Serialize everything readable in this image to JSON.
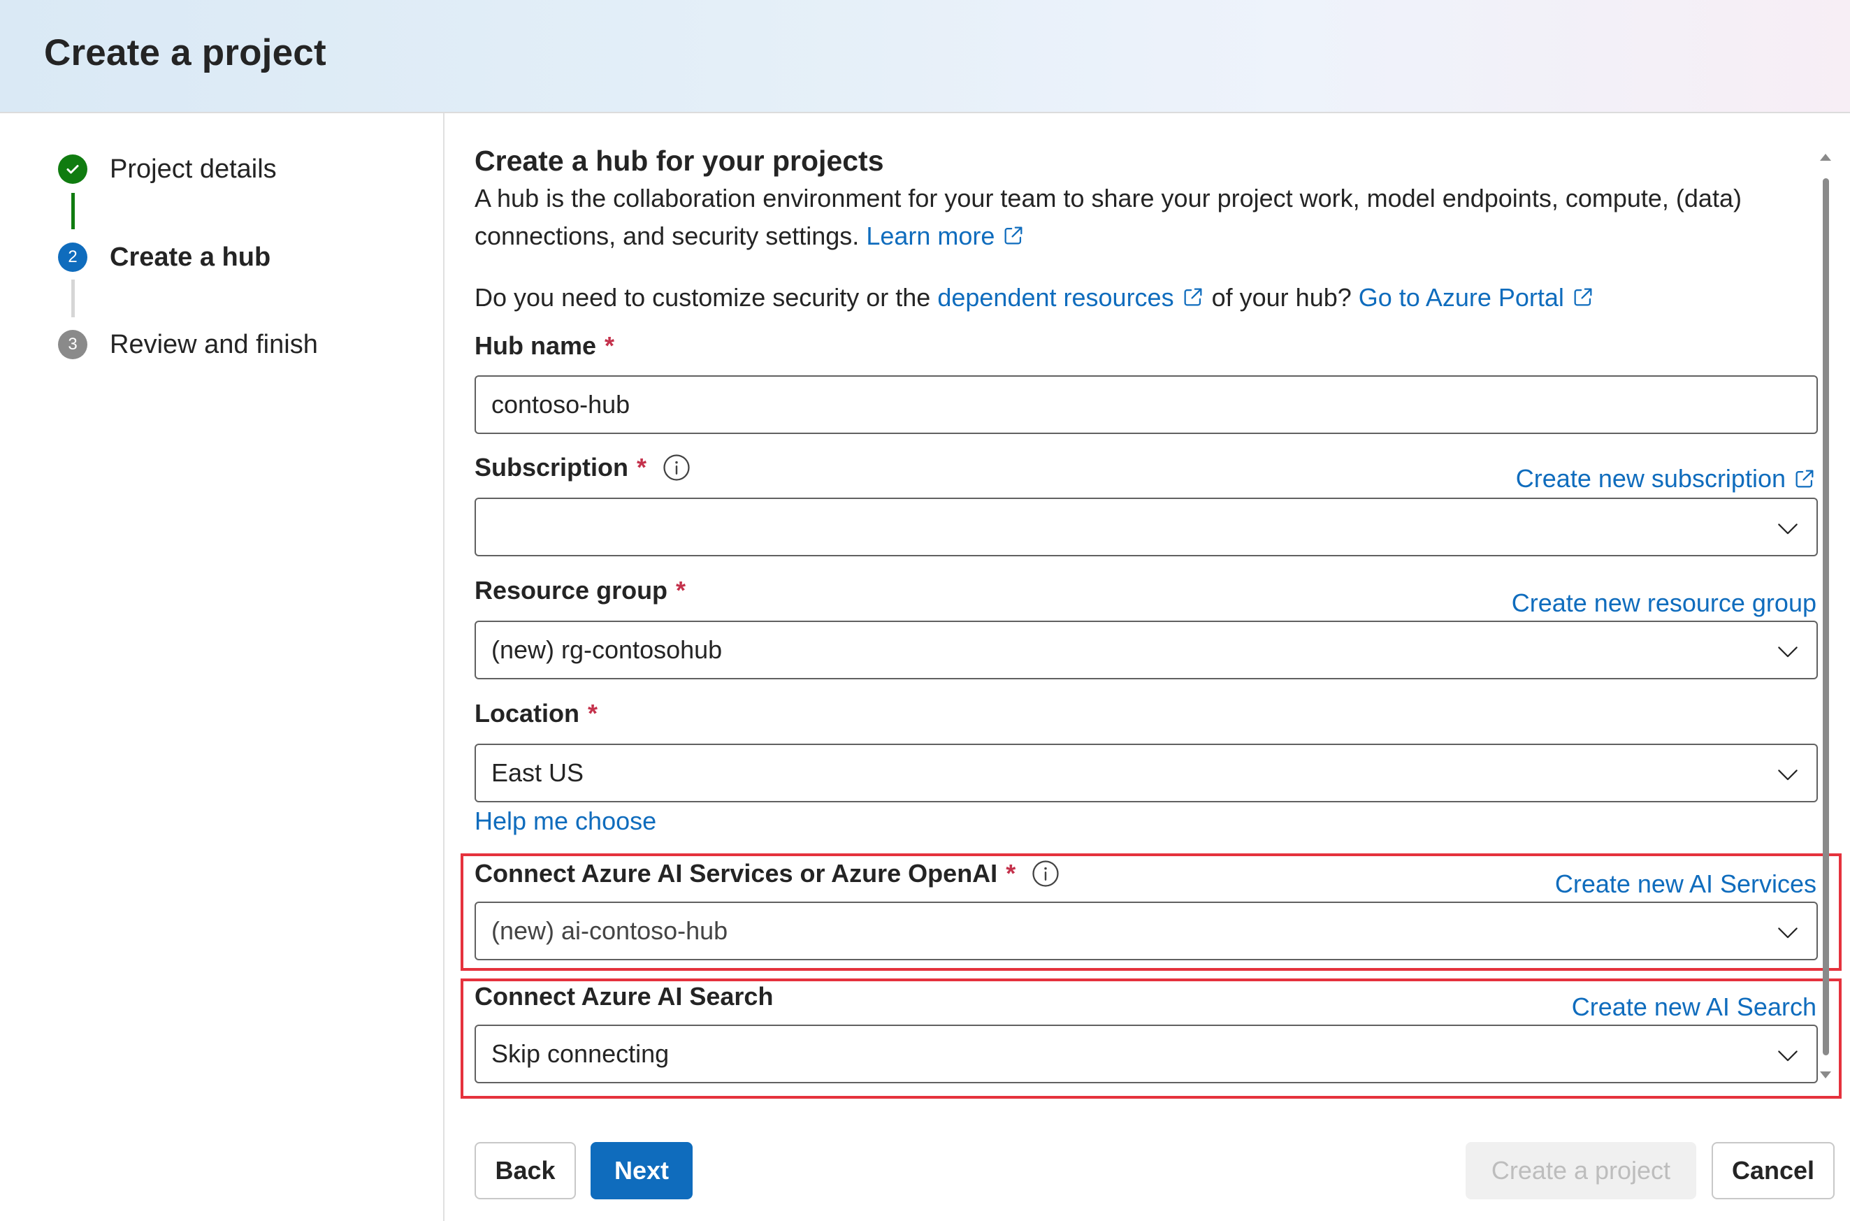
{
  "header": {
    "title": "Create a project"
  },
  "steps": [
    {
      "number": "1",
      "label": "Project details",
      "state": "done"
    },
    {
      "number": "2",
      "label": "Create a hub",
      "state": "current"
    },
    {
      "number": "3",
      "label": "Review and finish",
      "state": "todo"
    }
  ],
  "section": {
    "title": "Create a hub for your projects",
    "description": "A hub is the collaboration environment for your team to share your project work, model endpoints, compute, (data) connections, and security settings.",
    "learn_more": "Learn more",
    "customize_prefix": "Do you need to customize security or the",
    "dependent_resources": "dependent resources",
    "customize_middle": "of your hub?",
    "azure_portal": "Go to Azure Portal"
  },
  "fields": {
    "hub_name": {
      "label": "Hub name",
      "required": "*",
      "value": "contoso-hub"
    },
    "subscription": {
      "label": "Subscription",
      "required": "*",
      "value": "",
      "create_link": "Create new subscription"
    },
    "resource_group": {
      "label": "Resource group",
      "required": "*",
      "value": "(new) rg-contosohub",
      "create_link": "Create new resource group"
    },
    "location": {
      "label": "Location",
      "required": "*",
      "value": "East US",
      "help_link": "Help me choose"
    },
    "ai_services": {
      "label": "Connect Azure AI Services or Azure OpenAI",
      "required": "*",
      "value": "(new) ai-contoso-hub",
      "create_link": "Create new AI Services"
    },
    "ai_search": {
      "label": "Connect Azure AI Search",
      "value": "Skip connecting",
      "create_link": "Create new AI Search"
    }
  },
  "footer": {
    "back": "Back",
    "next": "Next",
    "create": "Create a project",
    "cancel": "Cancel"
  },
  "colors": {
    "accent": "#0f6cbd",
    "success": "#107c10",
    "required": "#c4314b",
    "highlight": "#e5323d"
  }
}
